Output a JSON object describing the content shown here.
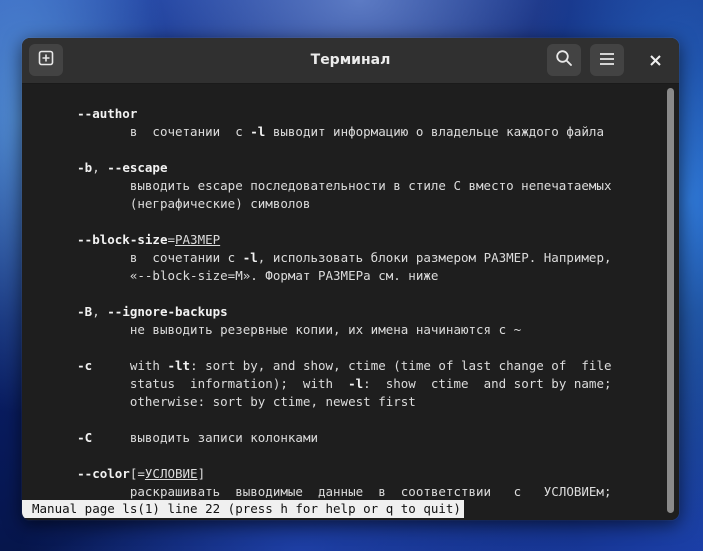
{
  "window": {
    "title": "Терминал"
  },
  "colors": {
    "terminal_bg": "#1e1e1e",
    "headerbar_bg": "#303030",
    "text": "#dcdcdc",
    "status_bg": "#f0f0f0"
  },
  "icons": {
    "new_tab": "new-tab-icon",
    "search": "search-icon",
    "menu": "hamburger-menu-icon",
    "close": "close-icon"
  },
  "man": {
    "author": {
      "flag": "--author",
      "desc": "в  сочетании  с ",
      "desc_flag": "-l",
      "desc_rest": " выводит информацию о владельце каждого файла"
    },
    "escape": {
      "flag_short": "-b",
      "sep": ", ",
      "flag_long": "--escape",
      "desc1": "выводить escape последовательности в стиле C вместо непечатаемых",
      "desc2": "(неграфические) символов"
    },
    "block_size": {
      "flag": "--block-size",
      "eq": "=",
      "arg": "РАЗМЕР",
      "desc1_a": "в  сочетании с ",
      "desc1_flag": "-l",
      "desc1_b": ", использовать блоки размером РАЗМЕР. Например,",
      "desc2": "«--block-size=M». Формат РАЗМЕРа см. ниже"
    },
    "ignore_backups": {
      "flag_short": "-B",
      "sep": ", ",
      "flag_long": "--ignore-backups",
      "desc": "не выводить резервные копии, их имена начинаются с ~"
    },
    "ctime": {
      "flag": "-c",
      "desc1_a": "with ",
      "desc1_flag": "-lt",
      "desc1_b": ": sort by, and show, ctime (time of last change of  file",
      "desc2_a": "status  information);  with  ",
      "desc2_flag": "-l",
      "desc2_b": ":  show  ctime  and sort by name;",
      "desc3": "otherwise: sort by ctime, newest first"
    },
    "columns": {
      "flag": "-C",
      "desc": "выводить записи колонками"
    },
    "color": {
      "flag": "--color",
      "arg_open": "[=",
      "arg": "УСЛОВИЕ",
      "arg_close": "]",
      "desc": "раскрашивать  выводимые  данные  в  соответствии   с   УСЛОВИЕм;"
    }
  },
  "status_line": "Manual page ls(1) line 22 (press h for help or q to quit)"
}
